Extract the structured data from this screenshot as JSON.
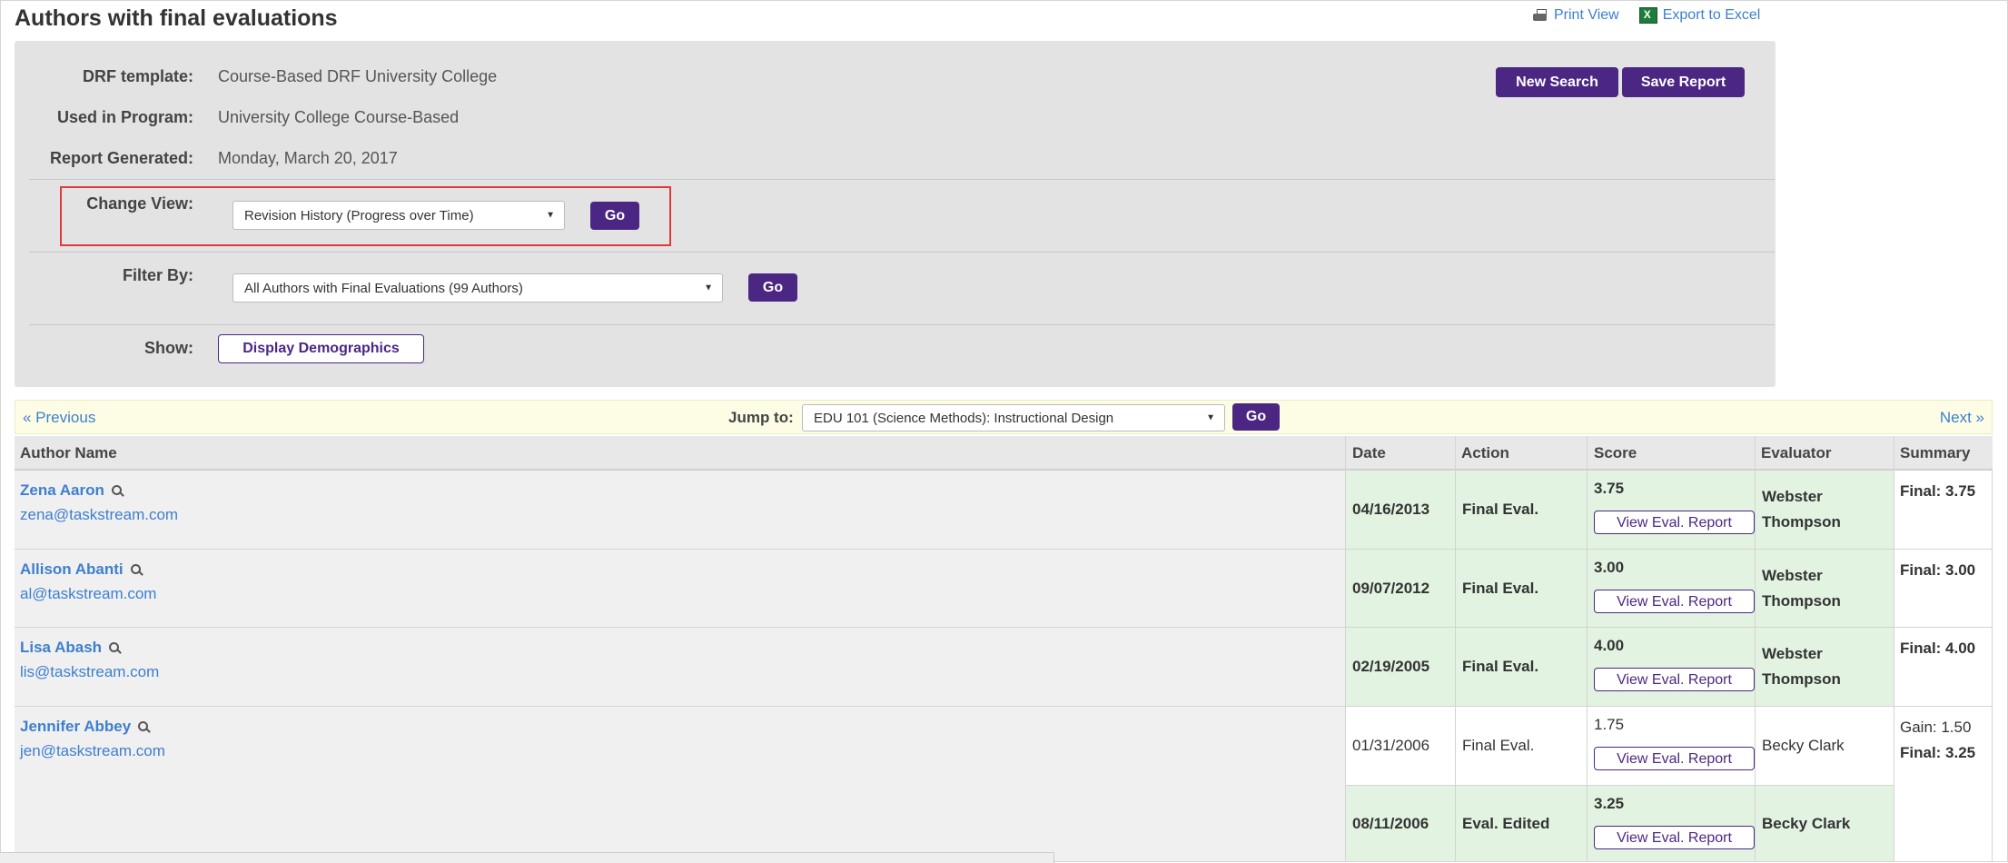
{
  "page": {
    "title": "Authors with final evaluations",
    "print_view": "Print View",
    "export_excel": "Export to Excel"
  },
  "report": {
    "drf_label": "DRF template:",
    "drf_value": "Course-Based DRF University College",
    "program_label": "Used in Program:",
    "program_value": "University College Course-Based",
    "generated_label": "Report Generated:",
    "generated_value": "Monday, March 20, 2017",
    "new_search": "New Search",
    "save_report": "Save Report",
    "change_view_label": "Change View:",
    "change_view_selected": "Revision History (Progress over Time)",
    "filter_label": "Filter By:",
    "filter_selected": "All Authors with Final Evaluations (99 Authors)",
    "show_label": "Show:",
    "display_demographics": "Display Demographics",
    "go": "Go"
  },
  "nav": {
    "previous": "« Previous",
    "next": "Next »",
    "jump_label": "Jump to:",
    "jump_selected": "EDU 101 (Science Methods): Instructional Design",
    "go": "Go"
  },
  "table": {
    "headers": [
      "Author Name",
      "Date",
      "Action",
      "Score",
      "Evaluator",
      "Summary"
    ],
    "view_report_label": "View Eval. Report",
    "rows": [
      {
        "name": "Zena Aaron",
        "email": "zena@taskstream.com",
        "date": "04/16/2013",
        "action": "Final Eval.",
        "score": "3.75",
        "evaluator": "Webster Thompson",
        "summary_final": "Final: 3.75"
      },
      {
        "name": "Allison Abanti",
        "email": "al@taskstream.com",
        "date": "09/07/2012",
        "action": "Final Eval.",
        "score": "3.00",
        "evaluator": "Webster Thompson",
        "summary_final": "Final: 3.00"
      },
      {
        "name": "Lisa Abash",
        "email": "lis@taskstream.com",
        "date": "02/19/2005",
        "action": "Final Eval.",
        "score": "4.00",
        "evaluator": "Webster Thompson",
        "summary_final": "Final: 4.00"
      },
      {
        "name": "Jennifer Abbey",
        "email": "jen@taskstream.com",
        "summary_gain": "Gain: 1.50",
        "summary_final": "Final: 3.25",
        "evals": [
          {
            "date": "01/31/2006",
            "action": "Final Eval.",
            "score": "1.75",
            "evaluator": "Becky Clark"
          },
          {
            "date": "08/11/2006",
            "action": "Eval. Edited",
            "score": "3.25",
            "evaluator": "Becky Clark"
          }
        ]
      }
    ]
  },
  "colors": {
    "accent": "#4b2783",
    "link": "#3d7fcf",
    "highlight_green": "#e2f3e2",
    "panel_bg": "#e3e3e3"
  }
}
